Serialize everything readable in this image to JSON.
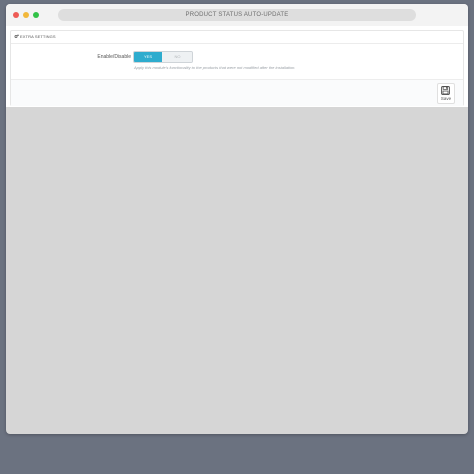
{
  "window": {
    "title": "PRODUCT STATUS AUTO-UPDATE"
  },
  "panel": {
    "heading_icon": "cogs-icon",
    "heading": "EXTRA SETTINGS",
    "field": {
      "label": "Enable/Disable",
      "options": [
        "YES",
        "NO"
      ],
      "selected": "YES",
      "help": "Apply this module's functionality to the products that were not modified after the installation."
    },
    "save": {
      "icon": "save-icon",
      "label": "Save"
    }
  },
  "colors": {
    "accent": "#2eacce",
    "close_dot": "#ee5b55",
    "minimize_dot": "#f2b83b",
    "maximize_dot": "#32c247"
  }
}
